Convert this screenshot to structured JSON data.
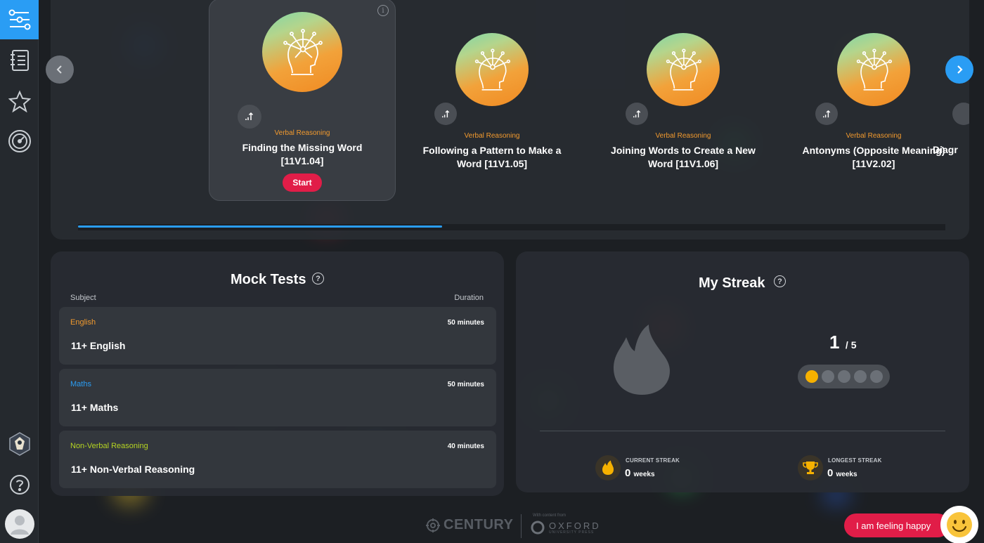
{
  "sidebar": {
    "items": [
      {
        "icon": "pathway-icon",
        "active": true
      },
      {
        "icon": "notebook-icon",
        "active": false
      },
      {
        "icon": "star-icon",
        "active": false
      },
      {
        "icon": "speedometer-icon",
        "active": false
      }
    ],
    "bottom": [
      "school-logo-icon",
      "help-icon",
      "avatar-icon"
    ]
  },
  "carousel": {
    "cards": [
      {
        "subject": "Verbal Reasoning",
        "title_line1": "Finding the Missing Word",
        "title_line2": "[11V1.04]",
        "start_label": "Start",
        "featured": true
      },
      {
        "subject": "Verbal Reasoning",
        "title_line1": "Following a Pattern to Make a",
        "title_line2": "Word [11V1.05]",
        "featured": false
      },
      {
        "subject": "Verbal Reasoning",
        "title_line1": "Joining Words to Create a New",
        "title_line2": "Word [11V1.06]",
        "featured": false
      },
      {
        "subject": "Verbal Reasoning",
        "title_line1": "Antonyms (Opposite Meaning)",
        "title_line2": "[11V2.02]",
        "featured": false
      },
      {
        "subject": "",
        "title_line1": "Diagr",
        "title_line2": "",
        "featured": false
      }
    ],
    "progress_fraction": 0.42
  },
  "mock_tests": {
    "title": "Mock Tests",
    "help": "?",
    "col_subject": "Subject",
    "col_duration": "Duration",
    "rows": [
      {
        "subject": "English",
        "subject_color": "#f29a2e",
        "duration": "50 minutes",
        "name": "11+ English"
      },
      {
        "subject": "Maths",
        "subject_color": "#2a9df4",
        "duration": "50 minutes",
        "name": "11+ Maths"
      },
      {
        "subject": "Non-Verbal Reasoning",
        "subject_color": "#b5d422",
        "duration": "40 minutes",
        "name": "11+ Non-Verbal Reasoning"
      }
    ]
  },
  "streak": {
    "title": "My Streak",
    "help": "?",
    "count": "1",
    "total": "/ 5",
    "filled_dots": 1,
    "total_dots": 5,
    "current_label": "CURRENT STREAK",
    "current_value": "0",
    "current_unit": "weeks",
    "longest_label": "LONGEST STREAK",
    "longest_value": "0",
    "longest_unit": "weeks"
  },
  "footer": {
    "century": "CENTURY",
    "with_content": "With content from",
    "oxford": "OXFORD",
    "oxford_sub": "UNIVERSITY PRESS"
  },
  "feedback": {
    "label": "I am feeling happy"
  }
}
